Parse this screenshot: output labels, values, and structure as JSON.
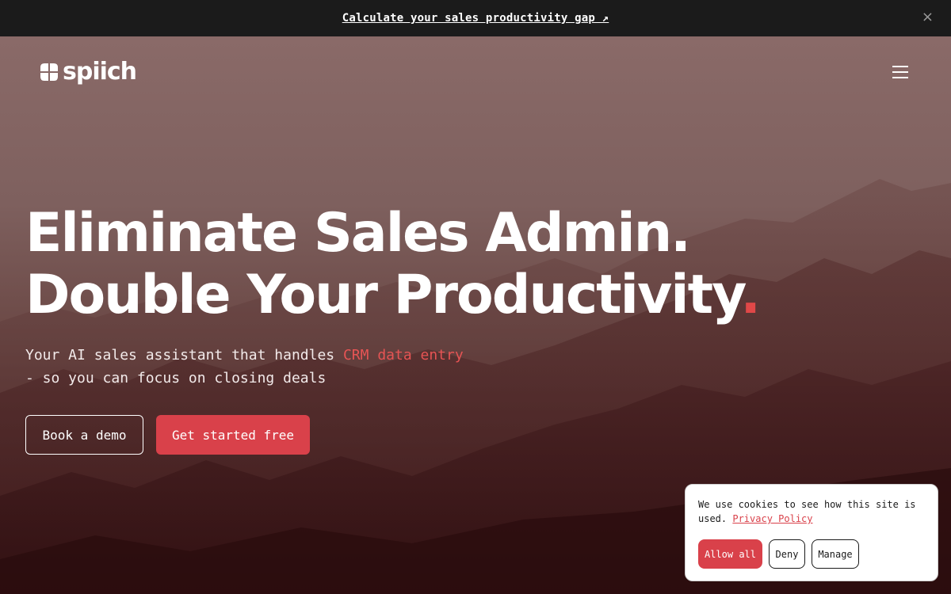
{
  "announcement": {
    "link_text": "Calculate your sales productivity gap ↗",
    "close_glyph": "×"
  },
  "header": {
    "logo_text": "spiich",
    "menu_icon": "hamburger-menu-icon"
  },
  "hero": {
    "headline_line1": "Eliminate Sales Admin.",
    "headline_line2": "Double Your Productivity",
    "headline_dot": ".",
    "subtitle_part1": "Your AI sales assistant that handles ",
    "subtitle_highlight": "CRM data entry",
    "subtitle_part2": "- so you can focus on closing deals",
    "book_demo_label": "Book a demo",
    "get_started_label": "Get started free"
  },
  "cookie_banner": {
    "text": "We use cookies to see how this site is used. ",
    "policy_link": "Privacy Policy",
    "allow_label": "Allow all",
    "deny_label": "Deny",
    "manage_label": "Manage"
  },
  "colors": {
    "accent": "#d9414a",
    "topbar_bg": "#1b1b1b",
    "hero_top": "#8a6a68",
    "hero_bottom": "#3a1416"
  }
}
